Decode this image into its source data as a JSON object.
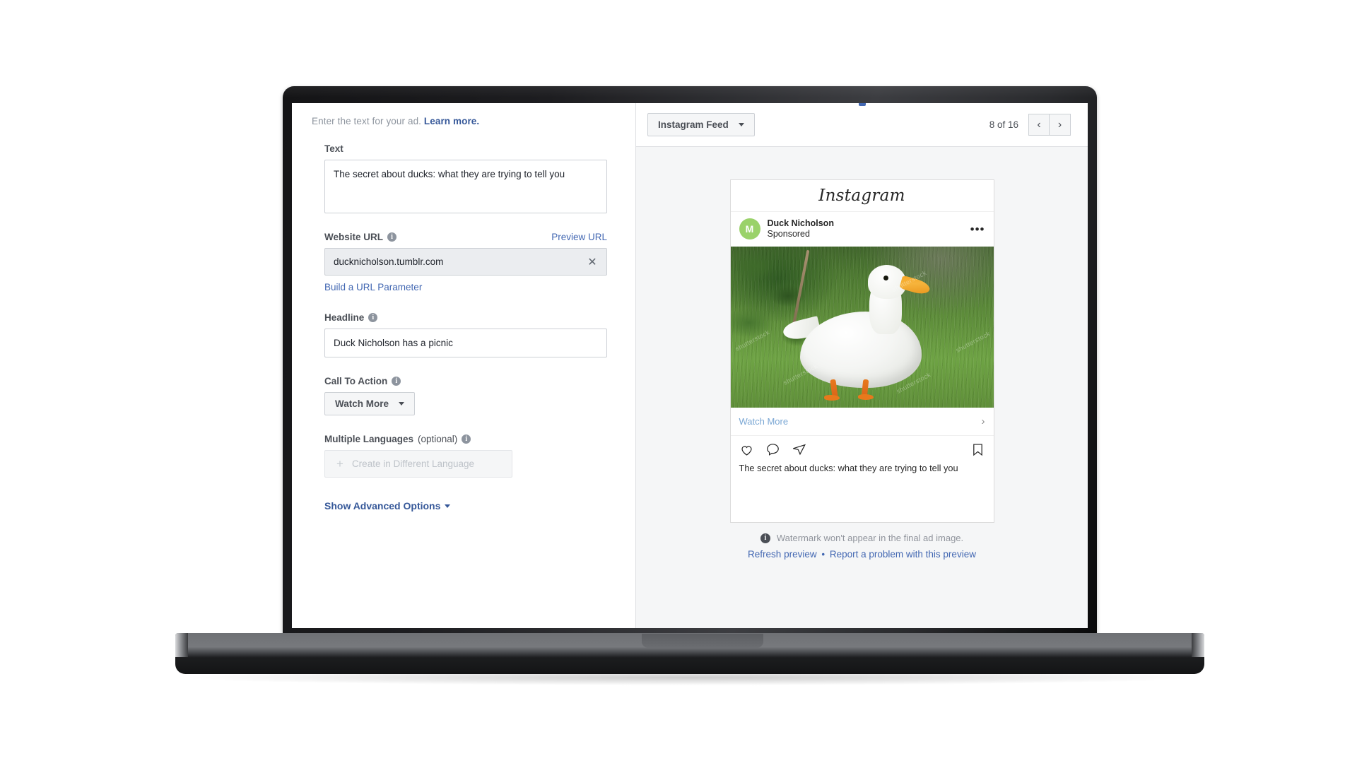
{
  "left_panel": {
    "helper_text": "Enter the text for your ad.",
    "helper_link": "Learn more.",
    "text_field": {
      "label": "Text",
      "value": "The secret about ducks: what they are trying to tell you"
    },
    "website_url": {
      "label": "Website URL",
      "info_glyph": "i",
      "preview_link": "Preview URL",
      "value": "ducknicholson.tumblr.com",
      "clear_glyph": "✕",
      "build_param_link": "Build a URL Parameter"
    },
    "headline": {
      "label": "Headline",
      "info_glyph": "i",
      "value": "Duck Nicholson has a picnic"
    },
    "call_to_action": {
      "label": "Call To Action",
      "info_glyph": "i",
      "selected": "Watch More"
    },
    "multiple_languages": {
      "label": "Multiple Languages",
      "optional_suffix": " (optional)",
      "info_glyph": "i",
      "button_label": "Create in Different Language",
      "plus_glyph": "+"
    },
    "advanced_options_label": "Show Advanced Options"
  },
  "preview_toolbar": {
    "placement_selected": "Instagram Feed",
    "page_count": "8 of 16",
    "prev_glyph": "‹",
    "next_glyph": "›"
  },
  "instagram_card": {
    "wordmark": "Instagram",
    "avatar_initial": "M",
    "user_name": "Duck Nicholson",
    "user_subtitle": "Sponsored",
    "more_glyph": "•••",
    "photo_alt": "White duck standing on green grass",
    "watermarks": [
      "shutterstock",
      "shutterstock",
      "shutterstock",
      "shutterstock",
      "shutterstock"
    ],
    "cta_text": "Watch More",
    "cta_chevron": "›",
    "actions": [
      "heart-icon",
      "comment-icon",
      "share-icon",
      "bookmark-icon"
    ],
    "caption": "The secret about ducks: what they are trying to tell you"
  },
  "preview_footer": {
    "watermark_note": "Watermark won't appear in the final ad image.",
    "info_glyph": "i",
    "refresh_link": "Refresh preview",
    "separator": "•",
    "report_link": "Report a problem with this preview"
  },
  "colors": {
    "facebook_blue": "#4267b2",
    "link_blue": "#365899",
    "panel_gray": "#f5f6f7",
    "border_gray": "#ccd0d5",
    "avatar_green": "#9ad26a"
  }
}
